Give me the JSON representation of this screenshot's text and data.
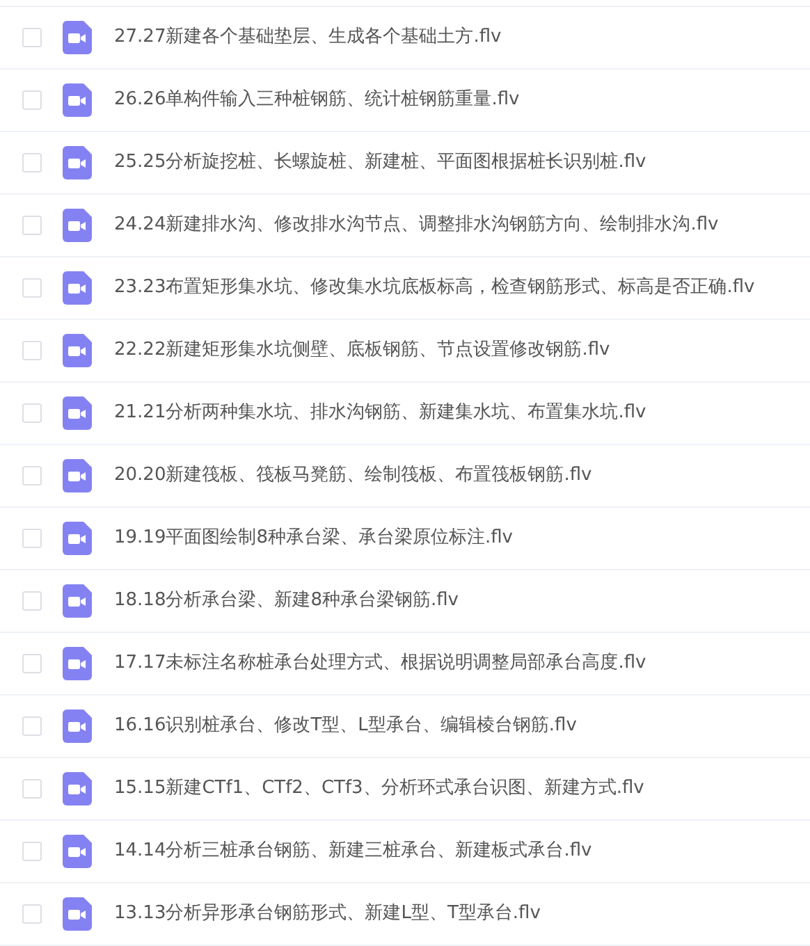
{
  "files": [
    {
      "name": "27.27新建各个基础垫层、生成各个基础土方.flv",
      "checked": false
    },
    {
      "name": "26.26单构件输入三种桩钢筋、统计桩钢筋重量.flv",
      "checked": false
    },
    {
      "name": "25.25分析旋挖桩、长螺旋桩、新建桩、平面图根据桩长识别桩.flv",
      "checked": false
    },
    {
      "name": "24.24新建排水沟、修改排水沟节点、调整排水沟钢筋方向、绘制排水沟.flv",
      "checked": false
    },
    {
      "name": "23.23布置矩形集水坑、修改集水坑底板标高，检查钢筋形式、标高是否正确.flv",
      "checked": false
    },
    {
      "name": "22.22新建矩形集水坑侧壁、底板钢筋、节点设置修改钢筋.flv",
      "checked": false
    },
    {
      "name": "21.21分析两种集水坑、排水沟钢筋、新建集水坑、布置集水坑.flv",
      "checked": false
    },
    {
      "name": "20.20新建筏板、筏板马凳筋、绘制筏板、布置筏板钢筋.flv",
      "checked": false
    },
    {
      "name": "19.19平面图绘制8种承台梁、承台梁原位标注.flv",
      "checked": false
    },
    {
      "name": "18.18分析承台梁、新建8种承台梁钢筋.flv",
      "checked": false
    },
    {
      "name": "17.17未标注名称桩承台处理方式、根据说明调整局部承台高度.flv",
      "checked": false
    },
    {
      "name": "16.16识别桩承台、修改T型、L型承台、编辑棱台钢筋.flv",
      "checked": false
    },
    {
      "name": "15.15新建CTf1、CTf2、CTf3、分析环式承台识图、新建方式.flv",
      "checked": false
    },
    {
      "name": "14.14分析三桩承台钢筋、新建三桩承台、新建板式承台.flv",
      "checked": false
    },
    {
      "name": "13.13分析异形承台钢筋形式、新建L型、T型承台.flv",
      "checked": false
    }
  ]
}
